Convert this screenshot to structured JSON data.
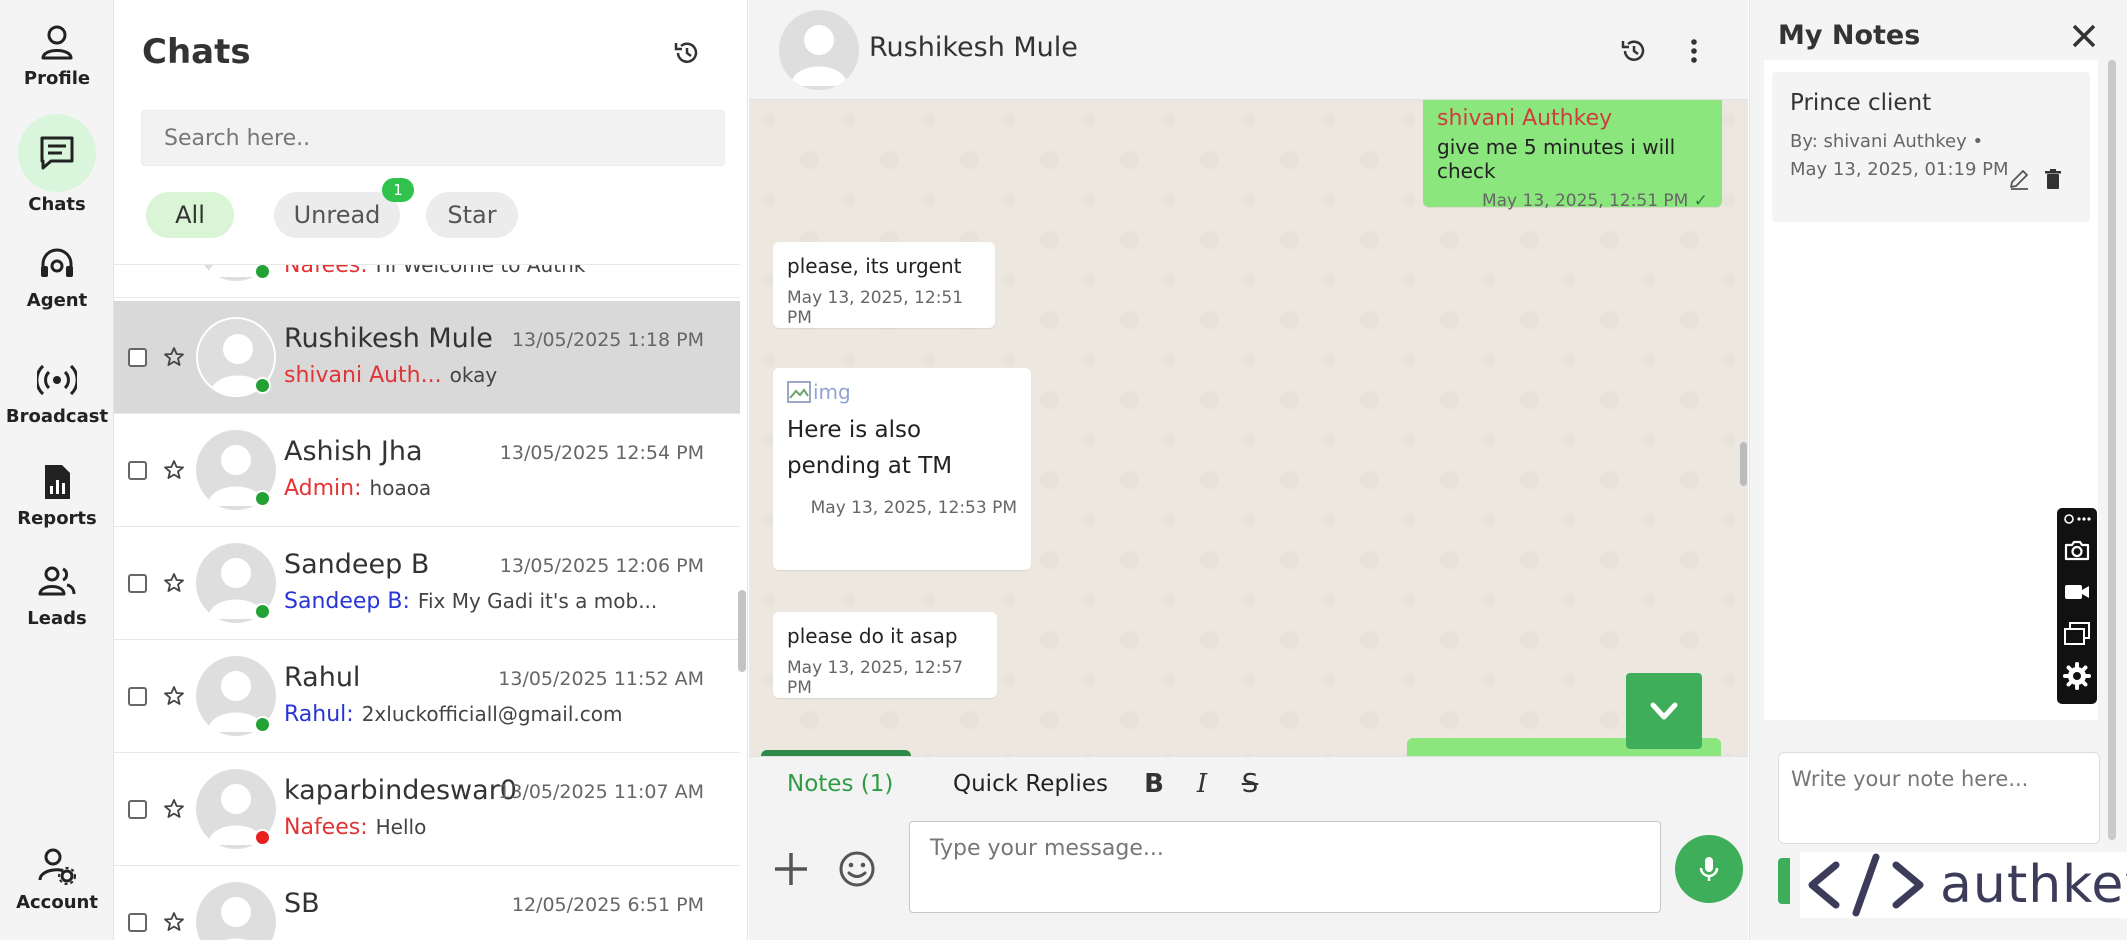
{
  "nav": {
    "items": [
      {
        "label": "Profile",
        "icon": "user-icon"
      },
      {
        "label": "Chats",
        "icon": "chat-icon",
        "active": true
      },
      {
        "label": "Agent",
        "icon": "headset-icon"
      },
      {
        "label": "Broadcast",
        "icon": "broadcast-icon"
      },
      {
        "label": "Reports",
        "icon": "report-icon"
      },
      {
        "label": "Leads",
        "icon": "users-icon"
      },
      {
        "label": "Account",
        "icon": "user-settings-icon"
      }
    ]
  },
  "list": {
    "title": "Chats",
    "search_placeholder": "Search here..",
    "filters": [
      {
        "label": "All",
        "active": true
      },
      {
        "label": "Unread",
        "badge": "1"
      },
      {
        "label": "Star"
      }
    ],
    "partial_top_row": {
      "sender": "Nafees:",
      "message": "Hi Welcome to Authk"
    },
    "rows": [
      {
        "name": "Rushikesh Mule",
        "time": "13/05/2025 1:18 PM",
        "sender": "shivani Auth...",
        "sender_color": "red",
        "message": "okay",
        "status": "online",
        "selected": true
      },
      {
        "name": "Ashish Jha",
        "time": "13/05/2025 12:54 PM",
        "sender": "Admin:",
        "sender_color": "red",
        "message": "hoaoa",
        "status": "online"
      },
      {
        "name": "Sandeep B",
        "time": "13/05/2025 12:06 PM",
        "sender": "Sandeep B:",
        "sender_color": "blue",
        "message": "Fix My Gadi it's a mob...",
        "status": "online"
      },
      {
        "name": "Rahul",
        "time": "13/05/2025 11:52 AM",
        "sender": "Rahul:",
        "sender_color": "blue",
        "message": "2xluckofficiall@gmail.com",
        "status": "online"
      },
      {
        "name": "kaparbindeswar0",
        "time": "13/05/2025 11:07 AM",
        "sender": "Nafees:",
        "sender_color": "red",
        "message": "Hello",
        "status": "offline"
      },
      {
        "name": "SB",
        "time": "12/05/2025 6:51 PM",
        "sender": "",
        "sender_color": "blue",
        "message": "",
        "status": "online"
      }
    ]
  },
  "chat": {
    "contact_name": "Rushikesh Mule",
    "messages": [
      {
        "dir": "out",
        "sender": "shivani Authkey",
        "text": "give me 5 minutes i will check",
        "time": "May 13, 2025, 12:51 PM"
      },
      {
        "dir": "in",
        "text": "please, its urgent",
        "time": "May 13, 2025, 12:51 PM"
      },
      {
        "dir": "in",
        "image_alt": "img",
        "text": "Here is also pending at TM",
        "time": "May 13, 2025, 12:53 PM"
      },
      {
        "dir": "in",
        "text": "please do it asap",
        "time": "May 13, 2025, 12:57 PM"
      }
    ],
    "tabs": {
      "notes": "Notes (1)",
      "quick_replies": "Quick Replies"
    },
    "format": {
      "bold": "B",
      "italic": "I",
      "strike": "S"
    },
    "input_placeholder": "Type your message..."
  },
  "notes": {
    "title": "My Notes",
    "items": [
      {
        "title": "Prince client",
        "meta": "By: shivani Authkey • May 13, 2025, 01:19 PM"
      }
    ],
    "input_placeholder": "Write your note here...",
    "brand": "authkey"
  },
  "colors": {
    "accent_green": "#3fae5b",
    "out_bubble": "#8ce67e",
    "online": "#23a135",
    "offline": "#e91e1e",
    "sender_red": "#e23434",
    "sender_blue": "#2735d6"
  }
}
